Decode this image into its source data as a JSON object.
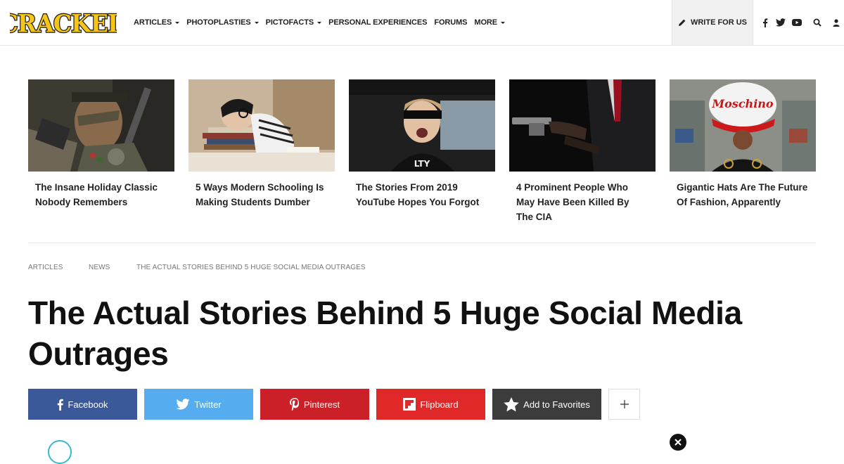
{
  "header": {
    "logo_text": "CRACKED",
    "nav": [
      {
        "label": "ARTICLES",
        "dropdown": true
      },
      {
        "label": "PHOTOPLASTIES",
        "dropdown": true
      },
      {
        "label": "PICTOFACTS",
        "dropdown": true
      },
      {
        "label": "PERSONAL EXPERIENCES",
        "dropdown": false
      },
      {
        "label": "FORUMS",
        "dropdown": false
      },
      {
        "label": "MORE",
        "dropdown": true
      }
    ],
    "write_label": "WRITE FOR US",
    "icons": [
      "facebook-icon",
      "twitter-icon",
      "youtube-icon",
      "search-icon",
      "user-icon"
    ]
  },
  "cards": [
    {
      "title": "The Insane Holiday Classic Nobody Remembers"
    },
    {
      "title": "5 Ways Modern Schooling Is Making Students Dumber"
    },
    {
      "title": "The Stories From 2019 YouTube Hopes You Forgot"
    },
    {
      "title": "4 Prominent People Who May Have Been Killed By The CIA"
    },
    {
      "title": "Gigantic Hats Are The Future Of Fashion, Apparently"
    }
  ],
  "breadcrumbs": [
    "ARTICLES",
    "NEWS",
    "THE ACTUAL STORIES BEHIND 5 HUGE SOCIAL MEDIA OUTRAGES"
  ],
  "article": {
    "title": "The Actual Stories Behind 5 Huge Social Media Outrages"
  },
  "share": [
    {
      "label": "Facebook",
      "color": "#3b5998",
      "icon": "facebook-icon"
    },
    {
      "label": "Twitter",
      "color": "#55acee",
      "icon": "twitter-icon"
    },
    {
      "label": "Pinterest",
      "color": "#cb2027",
      "icon": "pinterest-icon"
    },
    {
      "label": "Flipboard",
      "color": "#e12828",
      "icon": "flipboard-icon"
    },
    {
      "label": "Add to Favorites",
      "color": "#3c3c3c",
      "icon": "star-icon"
    }
  ],
  "colors": {
    "logo_yellow": "#f5c518",
    "write_bg": "#f1f1f1"
  }
}
